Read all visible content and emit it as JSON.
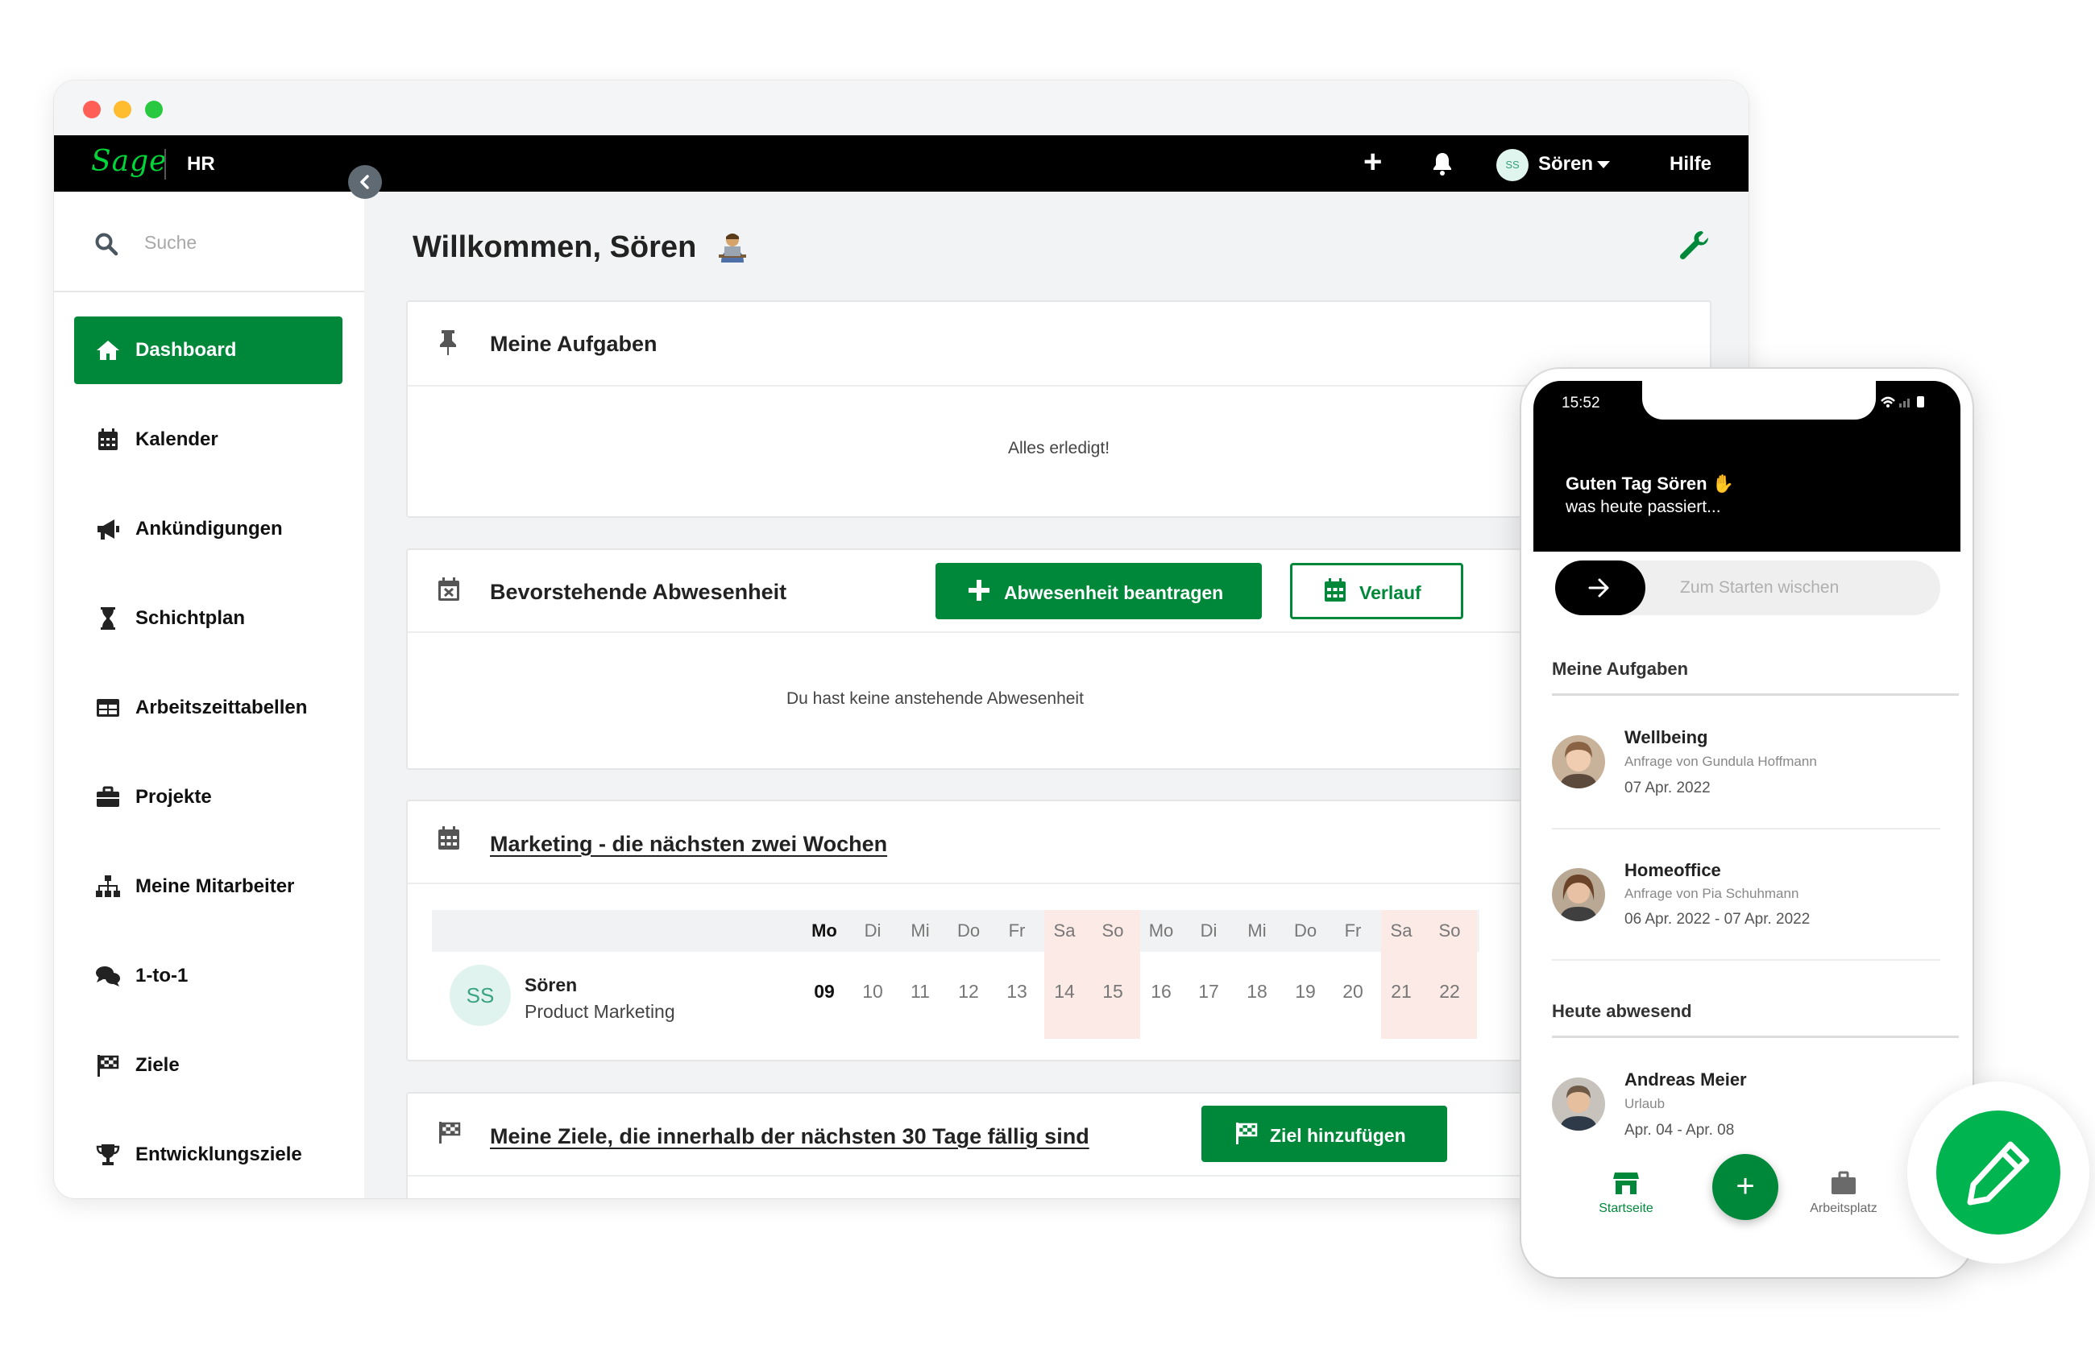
{
  "app": {
    "logo": "Sage",
    "module": "HR"
  },
  "topbar": {
    "plus_icon": "plus-icon",
    "bell_icon": "bell-icon",
    "avatar_initials": "SS",
    "user_name": "Sören",
    "help": "Hilfe"
  },
  "sidebar": {
    "search_placeholder": "Suche",
    "items": [
      {
        "label": "Dashboard",
        "icon": "home-icon",
        "active": true
      },
      {
        "label": "Kalender",
        "icon": "calendar-icon"
      },
      {
        "label": "Ankündigungen",
        "icon": "megaphone-icon"
      },
      {
        "label": "Schichtplan",
        "icon": "hourglass-icon"
      },
      {
        "label": "Arbeitszeittabellen",
        "icon": "table-icon"
      },
      {
        "label": "Projekte",
        "icon": "briefcase-icon"
      },
      {
        "label": "Meine Mitarbeiter",
        "icon": "org-chart-icon"
      },
      {
        "label": "1-to-1",
        "icon": "chat-bubbles-icon"
      },
      {
        "label": "Ziele",
        "icon": "flag-icon"
      },
      {
        "label": "Entwicklungsziele",
        "icon": "trophy-icon"
      }
    ]
  },
  "main": {
    "welcome": "Willkommen, Sören",
    "tasks": {
      "title": "Meine Aufgaben",
      "empty": "Alles erledigt!"
    },
    "absence": {
      "title": "Bevorstehende Abwesenheit",
      "request_button": "Abwesenheit beantragen",
      "history_button": "Verlauf",
      "empty": "Du hast keine anstehende Abwesenheit"
    },
    "marketing": {
      "title": "Marketing - die nächsten zwei Wochen",
      "days": [
        "Mo",
        "Di",
        "Mi",
        "Do",
        "Fr",
        "Sa",
        "So",
        "Mo",
        "Di",
        "Mi",
        "Do",
        "Fr",
        "Sa",
        "So"
      ],
      "dates": [
        "09",
        "10",
        "11",
        "12",
        "13",
        "14",
        "15",
        "16",
        "17",
        "18",
        "19",
        "20",
        "21",
        "22"
      ],
      "person": {
        "initials": "SS",
        "name": "Sören",
        "department": "Product Marketing"
      }
    },
    "goals": {
      "title": "Meine Ziele, die innerhalb der nächsten 30 Tage fällig sind",
      "add_button": "Ziel hinzufügen"
    }
  },
  "phone": {
    "time": "15:52",
    "greeting": "Guten Tag Sören",
    "greeting_sub": "was heute passiert...",
    "swipe_text": "Zum Starten wischen",
    "tasks_title": "Meine Aufgaben",
    "tasks": [
      {
        "title": "Wellbeing",
        "sub": "Anfrage von Gundula Hoffmann",
        "date": "07 Apr. 2022"
      },
      {
        "title": "Homeoffice",
        "sub": "Anfrage von Pia Schuhmann",
        "date": "06 Apr. 2022 - 07 Apr. 2022"
      }
    ],
    "absent_title": "Heute abwesend",
    "absent": [
      {
        "title": "Andreas Meier",
        "sub": "Urlaub",
        "date": "Apr. 04 - Apr. 08"
      }
    ],
    "tabs": {
      "home": "Startseite",
      "workplace": "Arbeitsplatz"
    }
  },
  "colors": {
    "brand_green": "#00883a",
    "logo_green": "#00d639",
    "weekend": "#fbeae5"
  }
}
